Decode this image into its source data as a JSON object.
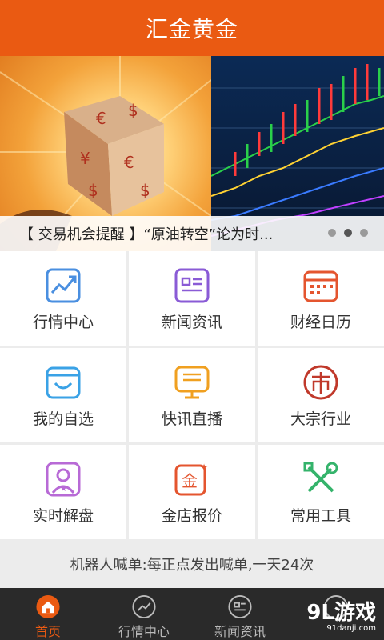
{
  "header": {
    "title": "汇金黄金"
  },
  "banner": {
    "caption": "【 交易机会提醒 】“原油转空”论为时...",
    "dots": 3,
    "active_dot": 1
  },
  "grid": {
    "items": [
      {
        "label": "行情中心",
        "icon": "trend-chart-icon",
        "color": "#4a8fe0"
      },
      {
        "label": "新闻资讯",
        "icon": "news-icon",
        "color": "#8a5bd6"
      },
      {
        "label": "财经日历",
        "icon": "calendar-icon",
        "color": "#e4552f"
      },
      {
        "label": "我的自选",
        "icon": "favorites-box-icon",
        "color": "#3aa2e6"
      },
      {
        "label": "快讯直播",
        "icon": "live-board-icon",
        "color": "#f0a020"
      },
      {
        "label": "大宗行业",
        "icon": "market-stamp-icon",
        "color": "#c0392b"
      },
      {
        "label": "实时解盘",
        "icon": "user-star-icon",
        "color": "#b86ad6"
      },
      {
        "label": "金店报价",
        "icon": "gold-shop-icon",
        "color": "#e4552f"
      },
      {
        "label": "常用工具",
        "icon": "tools-icon",
        "color": "#34b36b"
      }
    ]
  },
  "notice": {
    "text": "机器人喊单:每正点发出喊单,一天24次"
  },
  "tabs": [
    {
      "label": "首页",
      "icon": "home-icon",
      "active": true
    },
    {
      "label": "行情中心",
      "icon": "trend-icon",
      "active": false
    },
    {
      "label": "新闻资讯",
      "icon": "news-icon",
      "active": false
    },
    {
      "label": "",
      "icon": "more-icon",
      "active": false
    }
  ],
  "watermark": {
    "main": "9L游戏",
    "sub": "91danji.com"
  },
  "colors": {
    "accent": "#ea5a12",
    "tabbar_bg": "#2a2a2a"
  }
}
